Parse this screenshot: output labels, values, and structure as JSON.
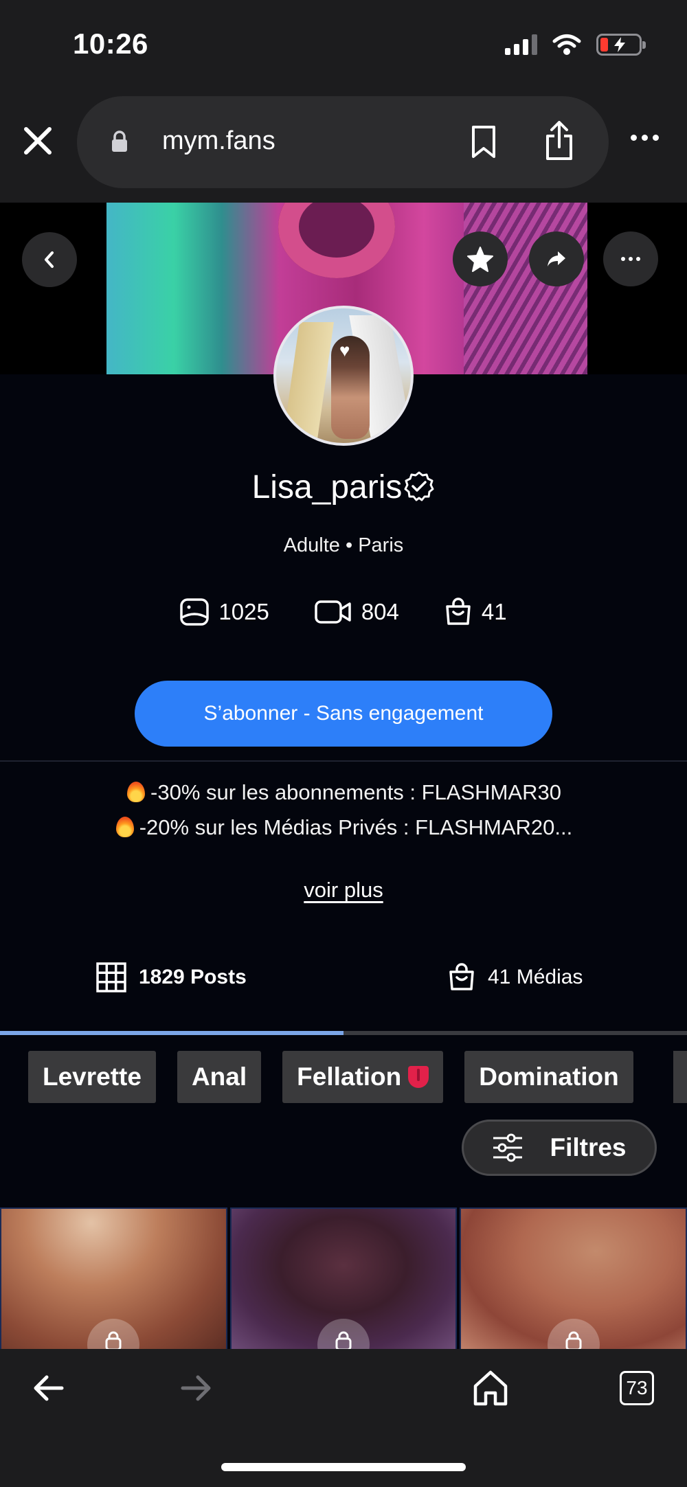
{
  "status_bar": {
    "time": "10:26",
    "icons": [
      "signal-icon",
      "wifi-icon",
      "battery-charging-icon"
    ]
  },
  "browser": {
    "url": "mym.fans",
    "icons": [
      "close-icon",
      "lock-icon",
      "bookmark-icon",
      "share-icon",
      "more-icon"
    ]
  },
  "header_buttons": [
    "back-icon",
    "star-icon",
    "share-arrow-icon",
    "more-icon"
  ],
  "profile": {
    "username": "Lisa_paris",
    "subtitle": "Adulte • Paris",
    "stats": {
      "photos": "1025",
      "videos": "804",
      "medias": "41"
    }
  },
  "subscribe": {
    "label": "S’abonner - Sans engagement",
    "color": "#2d7ff9"
  },
  "promos": [
    "-30% sur les abonnements : FLASHMAR30",
    "-20% sur les Médias Privés : FLASHMAR20..."
  ],
  "voir_plus": "voir plus",
  "tabs": {
    "posts": "1829 Posts",
    "medias": "41 Médias"
  },
  "tags": [
    "Levrette",
    "Anal",
    "Fellation",
    "Domination"
  ],
  "filters_label": "Filtres",
  "bottom_nav": {
    "tabs_count": "73",
    "icons": [
      "back-arrow-icon",
      "forward-arrow-icon",
      "home-icon",
      "tabs-icon"
    ]
  }
}
